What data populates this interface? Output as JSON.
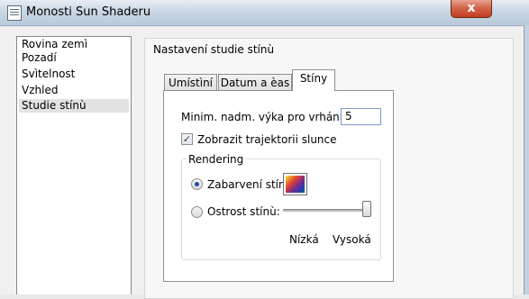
{
  "window": {
    "title": "Monosti Sun Shaderu",
    "close_glyph": "x"
  },
  "sidebar": {
    "items": [
      {
        "label": "Rovina zemì",
        "selected": false
      },
      {
        "label": "Pozadí",
        "selected": false
      },
      {
        "label": "Svìtelnost",
        "selected": false
      },
      {
        "label": "Vzhled",
        "selected": false
      },
      {
        "label": "Studie stínù",
        "selected": true
      }
    ]
  },
  "group": {
    "label": "Nastavení studie stínù"
  },
  "tabs": [
    {
      "label": "Umístìní",
      "active": false
    },
    {
      "label": "Datum a èas",
      "active": false
    },
    {
      "label": "Stíny",
      "active": true
    }
  ],
  "shadows": {
    "min_height_label": "Minim. nadm. výka pro vrhání stínù:",
    "min_height_value": "5",
    "trajectory_label": "Zobrazit trajektorii slunce",
    "trajectory_checked": true,
    "check_glyph": "✓",
    "rendering": {
      "legend": "Rendering",
      "coloring_label": "Zabarvení stínù",
      "sharpness_label": "Ostrost stínù:",
      "selected_option": "coloring",
      "slider_low_label": "Nízká",
      "slider_high_label": "Vysoká",
      "slider_level": 1.0
    }
  }
}
